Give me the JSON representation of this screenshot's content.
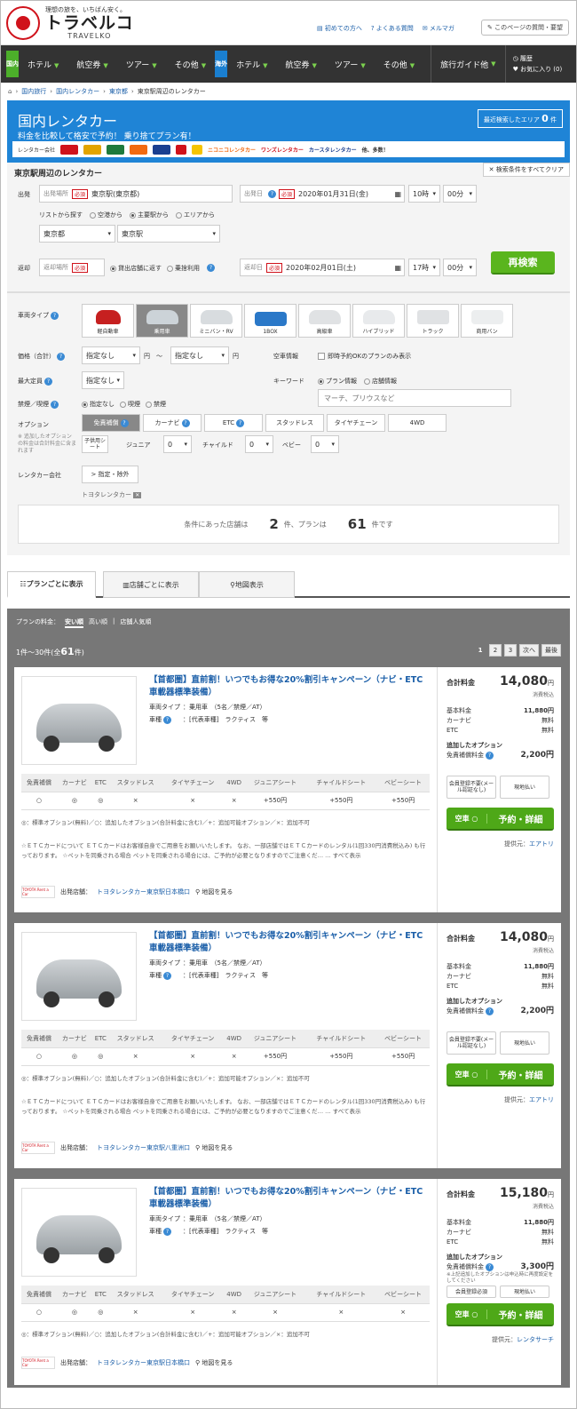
{
  "header": {
    "tagline": "理想の旅を、いちばん安く。",
    "brand": "トラベルコ",
    "brand_en": "TRAVELKO",
    "links": [
      "初めての方へ",
      "よくある質問",
      "メルマガ"
    ],
    "feedback": "このページの質問・要望"
  },
  "nav": {
    "domestic_tag": "国内",
    "overseas_tag": "海外",
    "domestic": [
      "ホテル",
      "航空券",
      "ツアー",
      "その他"
    ],
    "overseas": [
      "ホテル",
      "航空券",
      "ツアー",
      "その他"
    ],
    "guide": "旅行ガイド他",
    "history": "履歴",
    "favorites": "お気に入り (0)"
  },
  "breadcrumb": [
    "国内旅行",
    "国内レンタカー",
    "東京都",
    "東京駅周辺のレンタカー"
  ],
  "hero": {
    "title": "国内レンタカー",
    "subtitle": "料金を比較して格安で予約！ 乗り捨てプラン有！",
    "recent_label": "最近検索したエリア",
    "recent_count": "0",
    "recent_unit": "件",
    "company_label": "レンタカー会社",
    "companies_text": [
      "ニコニコレンタカー",
      "ワンズレンタカー",
      "カースタレンタカー"
    ],
    "more": "他、多数！"
  },
  "search": {
    "title": "東京駅周辺のレンタカー",
    "clear": "検索条件をすべてクリア",
    "depart_label": "出発",
    "place_label": "出発場所",
    "required": "必須",
    "place_value": "東京駅(東京都)",
    "date_label": "出発日",
    "date_value": "2020年01月31日(金)",
    "hour": "10時",
    "minute": "00分",
    "list_label": "リストから探す",
    "list_opts": [
      "空港から",
      "主要駅から",
      "エリアから"
    ],
    "pref": "東京都",
    "station": "東京駅",
    "return_label": "返却",
    "return_place_label": "返却場所",
    "return_opts": [
      "貸出店舗に返す",
      "乗捨利用"
    ],
    "return_date_label": "返却日",
    "return_date": "2020年02月01日(土)",
    "return_hour": "17時",
    "return_minute": "00分",
    "research": "再検索"
  },
  "filter": {
    "car_type_label": "車両タイプ",
    "car_types": [
      "軽自動車",
      "乗用車",
      "ミニバン・RV",
      "1BOX",
      "高級車",
      "ハイブリッド",
      "トラック",
      "商用バン"
    ],
    "price_label": "価格（合計）",
    "price_from": "指定なし",
    "price_to": "指定なし",
    "yen": "円",
    "tilde": "〜",
    "vacancy_label": "空車情報",
    "vacancy_opt": "即時予約OKのプランのみ表示",
    "capacity_label": "最大定員",
    "capacity": "指定なし",
    "keyword_label": "キーワード",
    "keyword_opts": [
      "プラン情報",
      "店舗情報"
    ],
    "keyword_placeholder": "マーチ、プリウスなど",
    "smoke_label": "禁煙／喫煙",
    "smoke_opts": [
      "指定なし",
      "喫煙",
      "禁煙"
    ],
    "option_label": "オプション",
    "option_note": "※ 追加したオプションの料金は合計料金に含まれます",
    "options": [
      "免責補償",
      "カーナビ",
      "ETC",
      "スタッドレス",
      "タイヤチェーン",
      "4WD"
    ],
    "child_label": "子供用シート",
    "child_seats": [
      "ジュニア",
      "チャイルド",
      "ベビー"
    ],
    "child_value": "0",
    "company_label": "レンタカー会社",
    "company_btn": "> 指定・除外",
    "company_tag": "トヨタレンタカー",
    "result_pre": "条件にあった店舗は",
    "shops": "2",
    "result_mid": "件、プランは",
    "plans": "61",
    "result_post": "件です"
  },
  "tabs": [
    "プランごとに表示",
    "店舗ごとに表示",
    "地図表示"
  ],
  "list": {
    "sort_label": "プランの料金：",
    "sorts": [
      "安い順",
      "高い順",
      "店舗人気順"
    ],
    "count_pre": "1件〜30件(全",
    "count_num": "61",
    "count_post": "件)",
    "pages": [
      "1",
      "2",
      "3",
      "次へ",
      "最後"
    ]
  },
  "option_headers": [
    "免責補償",
    "カーナビ",
    "ETC",
    "スタッドレス",
    "タイヤチェーン",
    "4WD",
    "ジュニアシート",
    "チャイルドシート",
    "ベビーシート"
  ],
  "legend": "◎：標準オプション(無料)／○：追加したオプション(合計料金に含む)／+：追加可能オプション／×：追加不可",
  "cards": [
    {
      "title": "【首都圏】直前割！いつでもお得な20%割引キャンペーン（ナビ・ETC車載器標準装備）",
      "type_label": "車両タイプ",
      "type": "：乗用車　（5名／禁煙／AT）",
      "car_label": "車種",
      "car": "：[代表車種]　ラクティス　等",
      "options": [
        "○",
        "◎",
        "◎",
        "×",
        "×",
        "×",
        "+550円",
        "+550円",
        "+550円"
      ],
      "note": "☆ＥＴＣカードについて ＥＴＣカードはお客様自身でご用意をお願いいたします。 なお、一部店舗ではＥＴＣカードのレンタル(1回330円消費税込み) も行っております。 ☆ペットを同乗される場合 ペットを同乗される場合には、ご予約が必要となりますのでご注意くだ… … すべて表示",
      "shop_label": "出発店舗：",
      "shop": "トヨタレンタカー東京駅日本橋口",
      "map": "地図を見る",
      "total_label": "合計料金",
      "total": "14,080",
      "yen": "円",
      "tax": "消費税込",
      "basic_label": "基本料金",
      "basic": "11,880円",
      "navi_label": "カーナビ",
      "navi": "無料",
      "etc_label": "ETC",
      "etc": "無料",
      "added_label": "追加したオプション",
      "insurance_label": "免責補償料金",
      "insurance": "2,200円",
      "btn1": "会員登録不要(メール認証なし)",
      "btn2": "現地払い",
      "vacant": "空車 ○",
      "book": "予約・詳細",
      "provider_label": "提供元：",
      "provider": "エアトリ"
    },
    {
      "title": "【首都圏】直前割！いつでもお得な20%割引キャンペーン（ナビ・ETC車載器標準装備）",
      "type_label": "車両タイプ",
      "type": "：乗用車　（5名／禁煙／AT）",
      "car_label": "車種",
      "car": "：[代表車種]　ラクティス　等",
      "options": [
        "○",
        "◎",
        "◎",
        "×",
        "×",
        "×",
        "+550円",
        "+550円",
        "+550円"
      ],
      "note": "☆ＥＴＣカードについて ＥＴＣカードはお客様自身でご用意をお願いいたします。 なお、一部店舗ではＥＴＣカードのレンタル(1回330円消費税込み) も行っております。 ☆ペットを同乗される場合 ペットを同乗される場合には、ご予約が必要となりますのでご注意くだ… … すべて表示",
      "shop_label": "出発店舗：",
      "shop": "トヨタレンタカー東京駅八重洲口",
      "map": "地図を見る",
      "total_label": "合計料金",
      "total": "14,080",
      "yen": "円",
      "tax": "消費税込",
      "basic_label": "基本料金",
      "basic": "11,880円",
      "navi_label": "カーナビ",
      "navi": "無料",
      "etc_label": "ETC",
      "etc": "無料",
      "added_label": "追加したオプション",
      "insurance_label": "免責補償料金",
      "insurance": "2,200円",
      "btn1": "会員登録不要(メール認証なし)",
      "btn2": "現地払い",
      "vacant": "空車 ○",
      "book": "予約・詳細",
      "provider_label": "提供元：",
      "provider": "エアトリ"
    },
    {
      "title": "【首都圏】直前割！いつでもお得な20%割引キャンペーン（ナビ・ETC車載器標準装備）",
      "type_label": "車両タイプ",
      "type": "：乗用車　（5名／禁煙／AT）",
      "car_label": "車種",
      "car": "：[代表車種]　ラクティス　等",
      "options": [
        "○",
        "◎",
        "◎",
        "×",
        "×",
        "×",
        "×",
        "×",
        "×"
      ],
      "note": "◎：標準オプション(無料)／○：追加したオプション(合計料金に含む)／+：追加可能オプション／×：追加不可",
      "shop_label": "出発店舗：",
      "shop": "トヨタレンタカー東京駅日本橋口",
      "map": "地図を見る",
      "total_label": "合計料金",
      "total": "15,180",
      "yen": "円",
      "tax": "消費税込",
      "basic_label": "基本料金",
      "basic": "11,880円",
      "navi_label": "カーナビ",
      "navi": "無料",
      "etc_label": "ETC",
      "etc": "無料",
      "added_label": "追加したオプション",
      "insurance_label": "免責補償料金",
      "insurance": "3,300円",
      "extra_note": "※上記追加したオプションは申込時に再度設定をしてください",
      "btn1": "会員登録必須",
      "btn2": "現地払い",
      "vacant": "空車 ○",
      "book": "予約・詳細",
      "provider_label": "提供元：",
      "provider": "レンタサーチ"
    }
  ]
}
